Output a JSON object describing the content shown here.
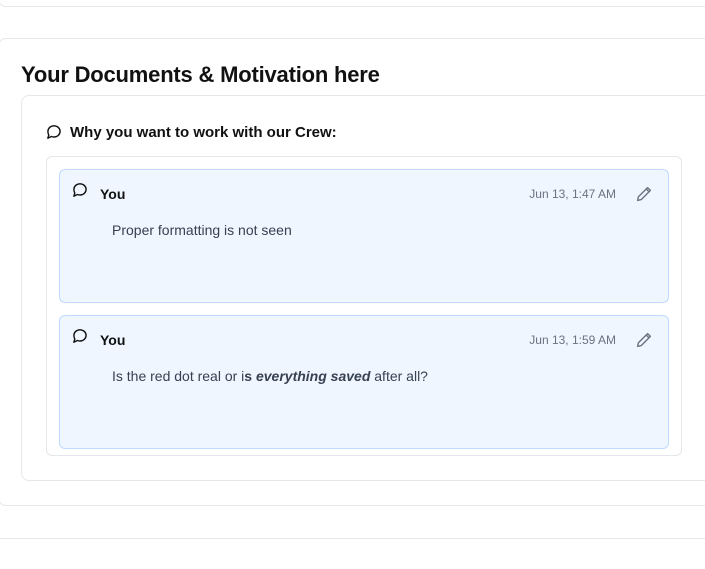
{
  "section": {
    "title": "Your Documents & Motivation here"
  },
  "question": {
    "label": "Why you want to work with our Crew:",
    "icon": "chat-bubble-icon"
  },
  "comments": [
    {
      "author": "You",
      "timestamp": "Jun 13, 1:47 AM",
      "body_text": "Proper formatting is not seen",
      "icon": "chat-bubble-icon",
      "action_icon": "pencil-icon"
    },
    {
      "author": "You",
      "timestamp": "Jun 13, 1:59 AM",
      "body_parts": {
        "plain_1": "Is the red dot real or i",
        "bold_1": "s ",
        "bold_italic": "everything saved",
        "plain_2": " after all?"
      },
      "icon": "chat-bubble-icon",
      "action_icon": "pencil-icon"
    }
  ],
  "colors": {
    "comment_bg": "#eff6ff",
    "comment_border": "#bfdbfe",
    "card_border": "#e5e7eb",
    "muted_text": "#6b7280"
  }
}
